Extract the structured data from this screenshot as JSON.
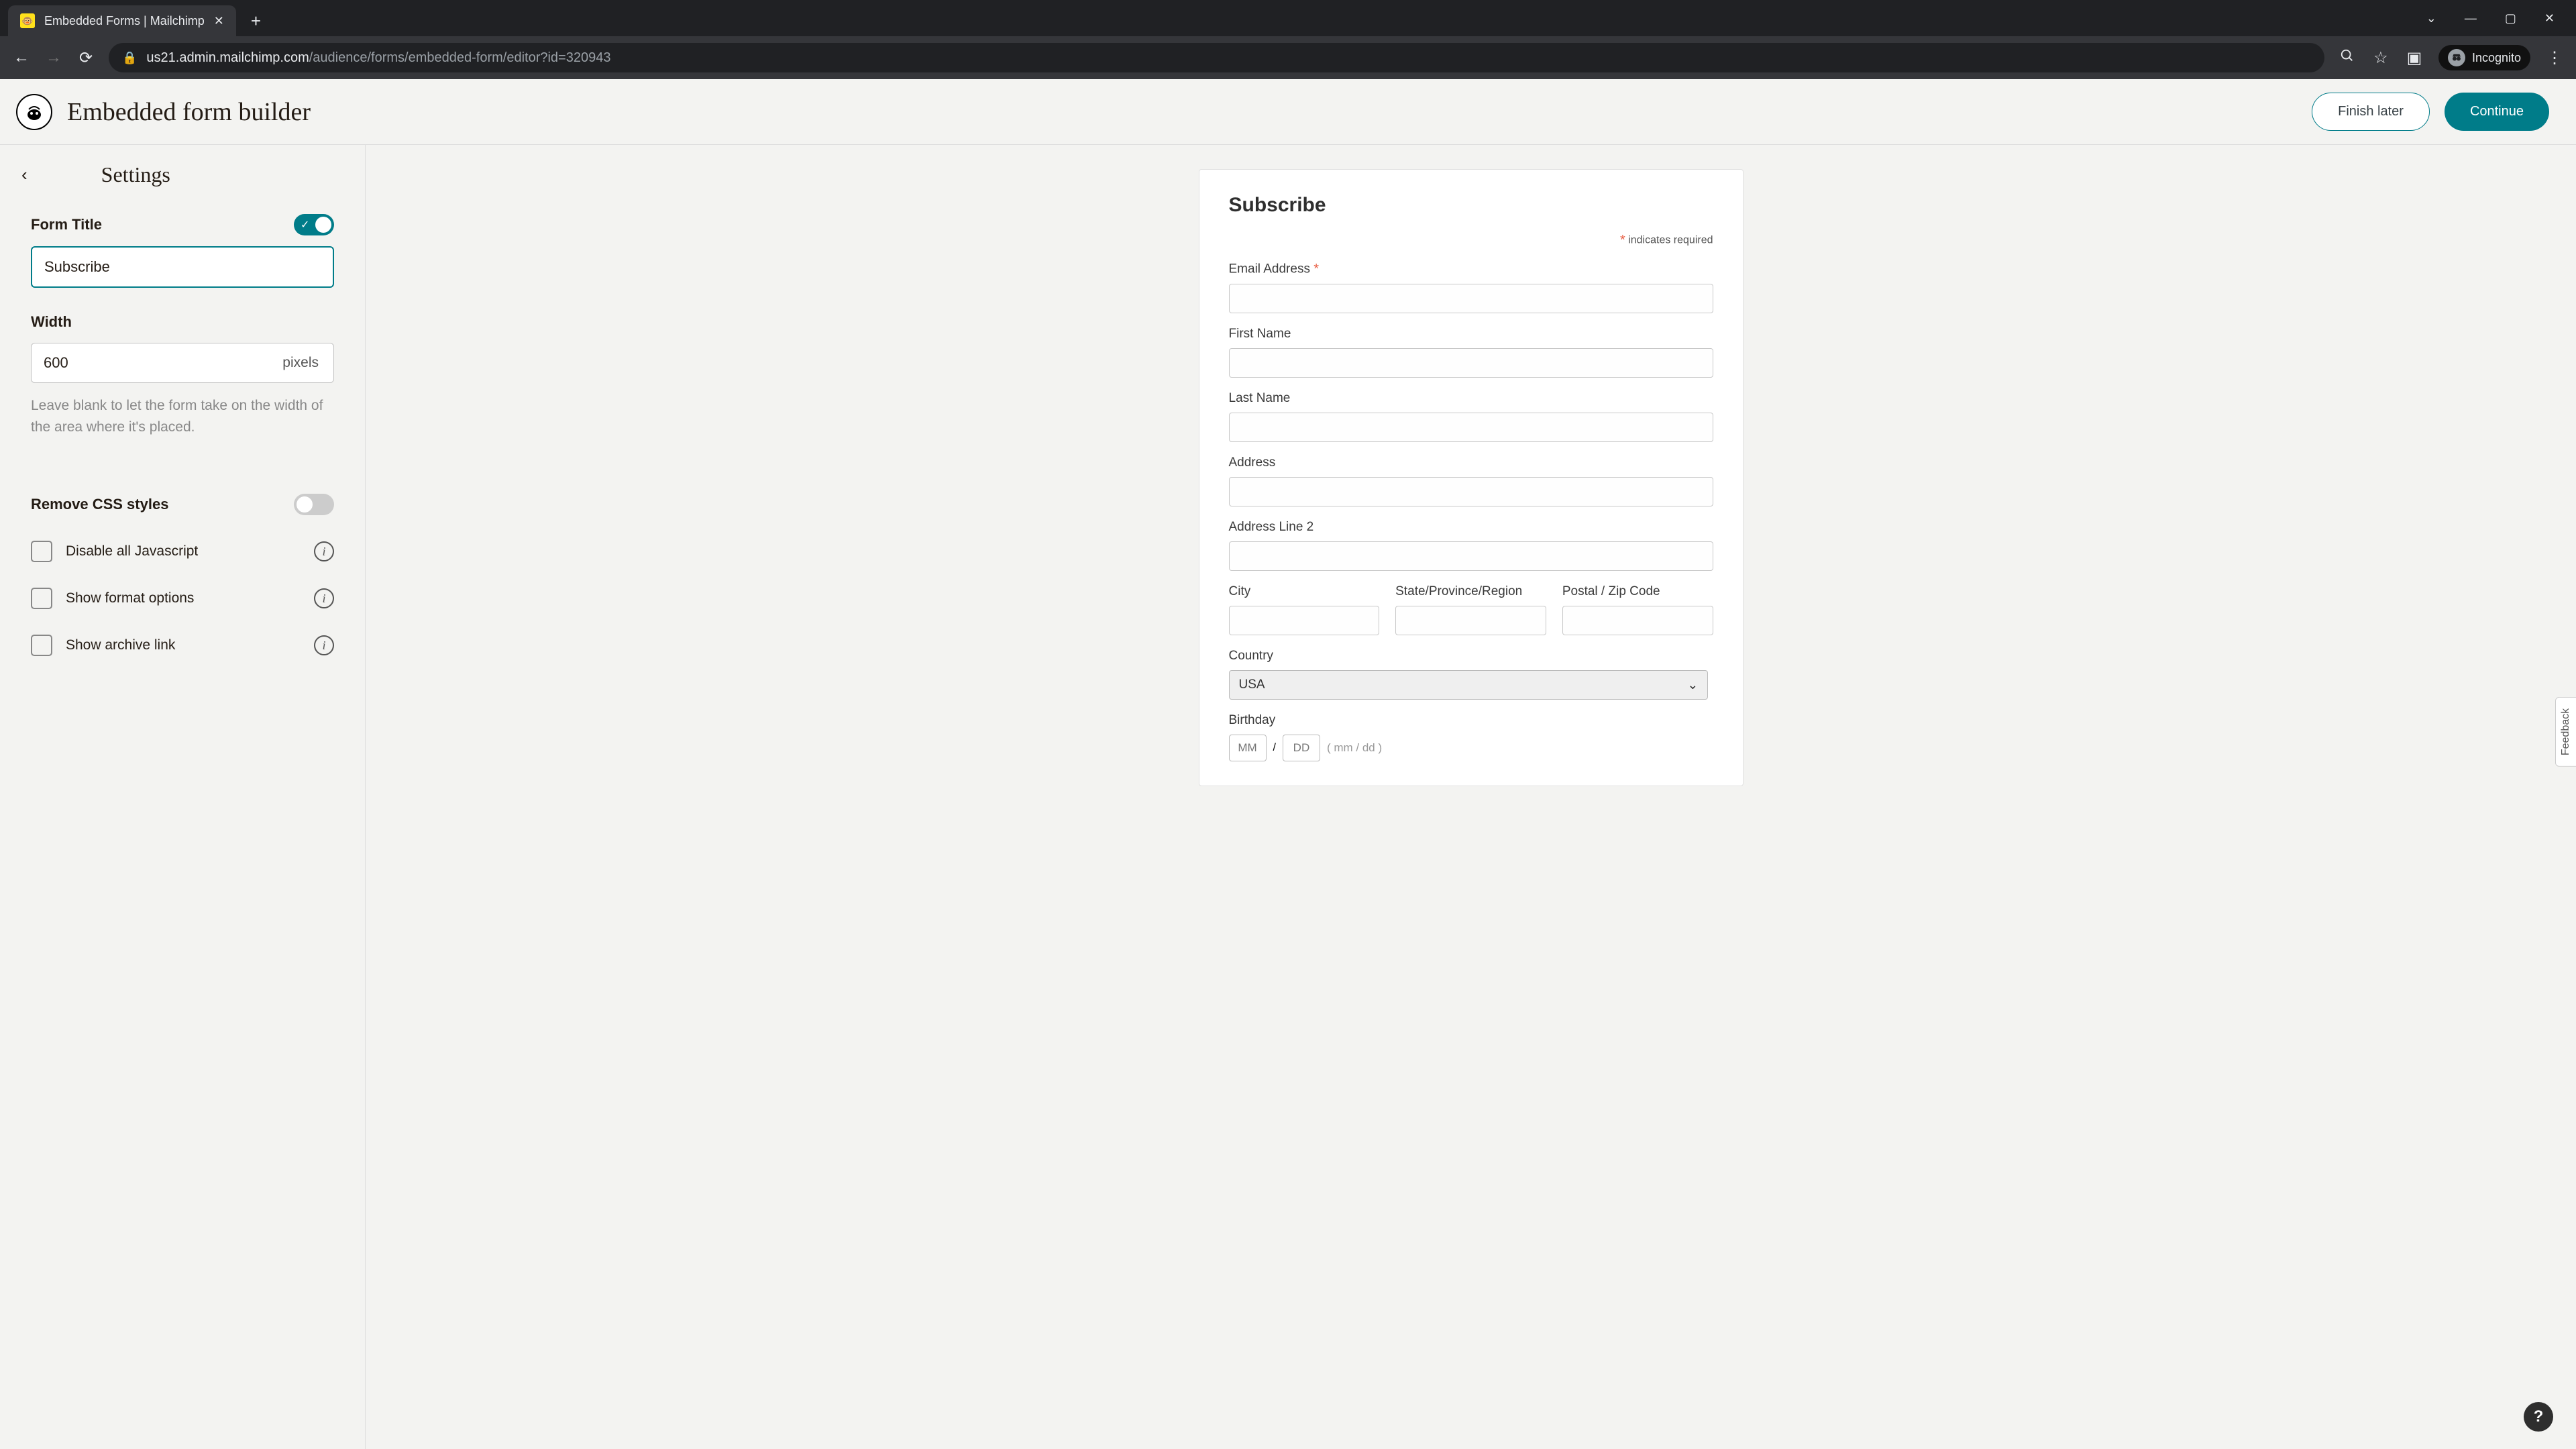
{
  "browser": {
    "tab_title": "Embedded Forms | Mailchimp",
    "url_host": "us21.admin.mailchimp.com",
    "url_path": "/audience/forms/embedded-form/editor?id=320943",
    "incognito": "Incognito"
  },
  "header": {
    "title": "Embedded form builder",
    "finish_later": "Finish later",
    "continue": "Continue"
  },
  "sidebar": {
    "title": "Settings",
    "form_title_label": "Form Title",
    "form_title_value": "Subscribe",
    "width_label": "Width",
    "width_value": "600",
    "width_unit": "pixels",
    "width_hint": "Leave blank to let the form take on the width of the area where it's placed.",
    "remove_css_label": "Remove CSS styles",
    "disable_js_label": "Disable all Javascript",
    "format_options_label": "Show format options",
    "archive_link_label": "Show archive link"
  },
  "preview": {
    "title": "Subscribe",
    "required_note": "indicates required",
    "fields": {
      "email": "Email Address",
      "first_name": "First Name",
      "last_name": "Last Name",
      "address": "Address",
      "address2": "Address Line 2",
      "city": "City",
      "state": "State/Province/Region",
      "postal": "Postal / Zip Code",
      "country": "Country",
      "country_value": "USA",
      "birthday": "Birthday",
      "bday_mm": "MM",
      "bday_dd": "DD",
      "bday_hint": "( mm / dd )"
    }
  },
  "feedback": "Feedback",
  "help": "?"
}
